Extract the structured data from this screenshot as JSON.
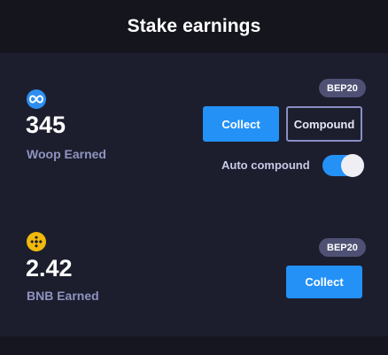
{
  "header": {
    "title": "Stake earnings"
  },
  "woop": {
    "icon": "infinity-icon",
    "icon_color": "#2d8ef0",
    "amount": "345",
    "label": "Woop Earned",
    "badge": "BEP20",
    "collect_label": "Collect",
    "compound_label": "Compound",
    "auto_compound_label": "Auto compound",
    "auto_compound_on": true
  },
  "bnb": {
    "icon": "bnb-icon",
    "icon_color": "#f0b90b",
    "amount": "2.42",
    "label": "BNB Earned",
    "badge": "BEP20",
    "collect_label": "Collect"
  },
  "colors": {
    "accent": "#2491f7",
    "panel": "#1c1e2e",
    "background": "#15161f",
    "badge": "#4e5173",
    "muted_text": "#8f93bf"
  }
}
